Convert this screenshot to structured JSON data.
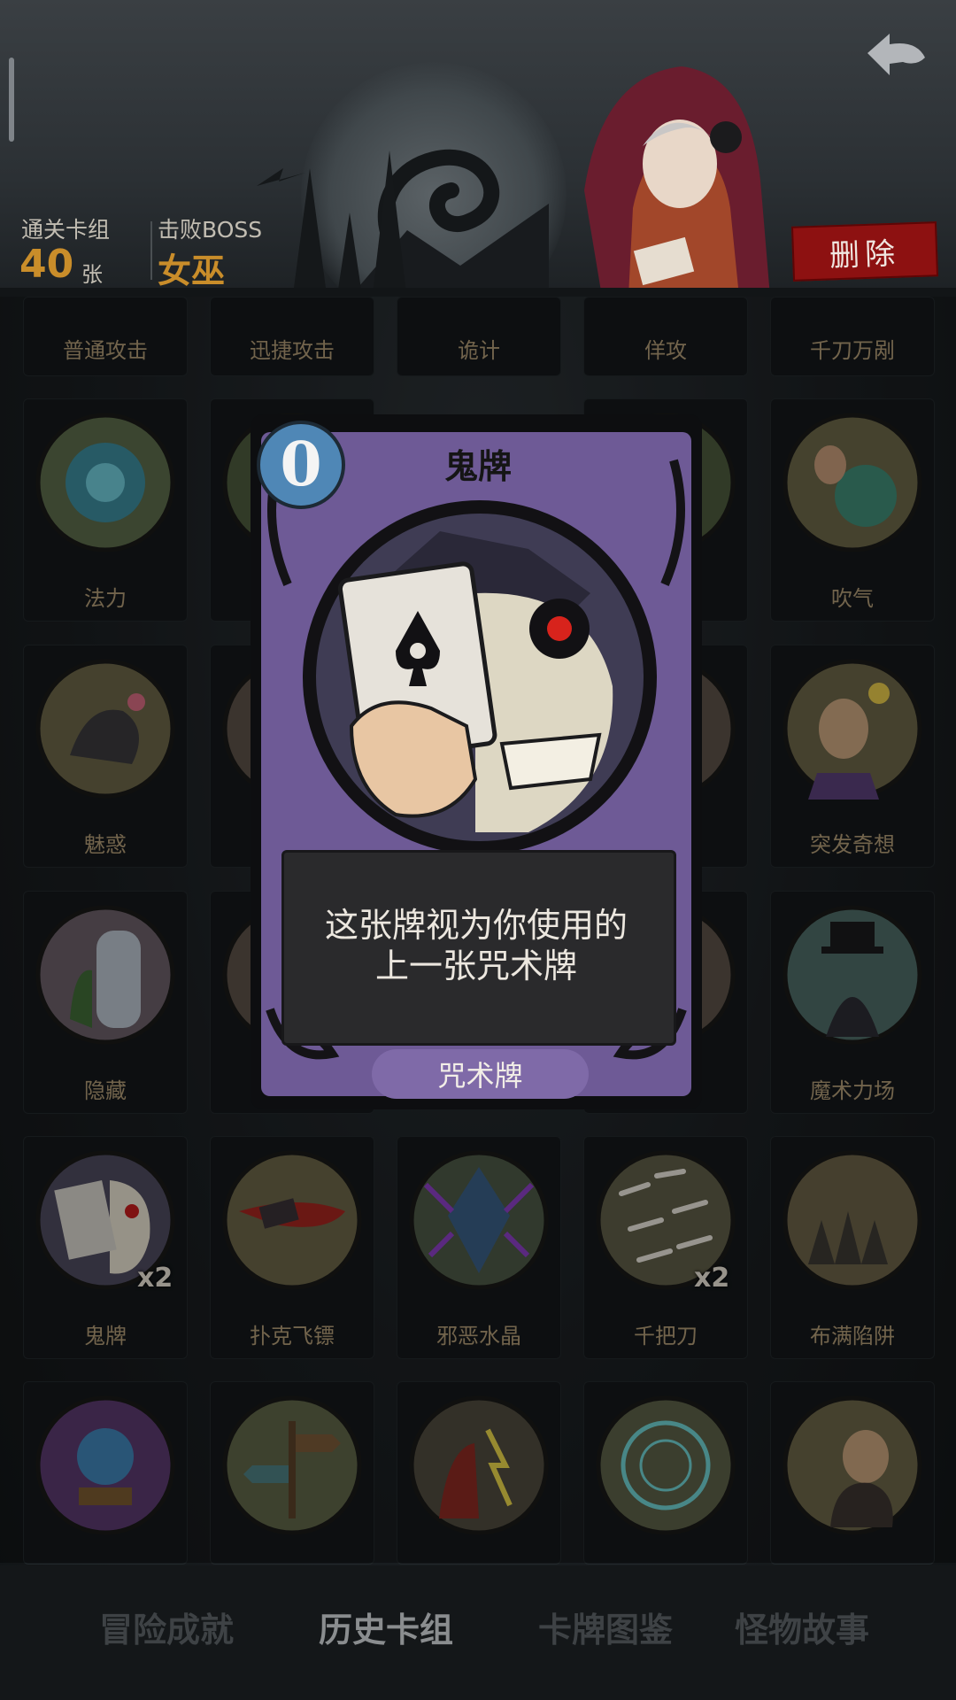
{
  "header": {
    "cleared_deck_label": "通关卡组",
    "cleared_deck_count": "40",
    "cleared_deck_unit": "张",
    "boss_label": "击败BOSS",
    "boss_name": "女巫",
    "delete_label": "删除"
  },
  "grid": {
    "row1": [
      "普通攻击",
      "迅捷攻击",
      "诡计",
      "佯攻",
      "千刀万剐"
    ],
    "row2": [
      "法力",
      "吹气"
    ],
    "row3": [
      "魅惑",
      "突发奇想"
    ],
    "row4": [
      "隐藏",
      "魔术力场"
    ],
    "row5": [
      "鬼牌",
      "扑克飞镖",
      "邪恶水晶",
      "千把刀",
      "布满陷阱"
    ],
    "multiplier": "x2"
  },
  "popup": {
    "cost": "0",
    "title": "鬼牌",
    "description_line1": "这张牌视为你使用的",
    "description_line2": "上一张咒术牌",
    "type": "咒术牌"
  },
  "nav": {
    "tabs": [
      "冒险成就",
      "历史卡组",
      "卡牌图鉴",
      "怪物故事"
    ],
    "active": "历史卡组"
  },
  "colors": {
    "card_frame": "#6e5a96",
    "cost_badge": "#4f87b6",
    "delete_button": "#8d1111",
    "count_gold": "#c98d2a"
  }
}
